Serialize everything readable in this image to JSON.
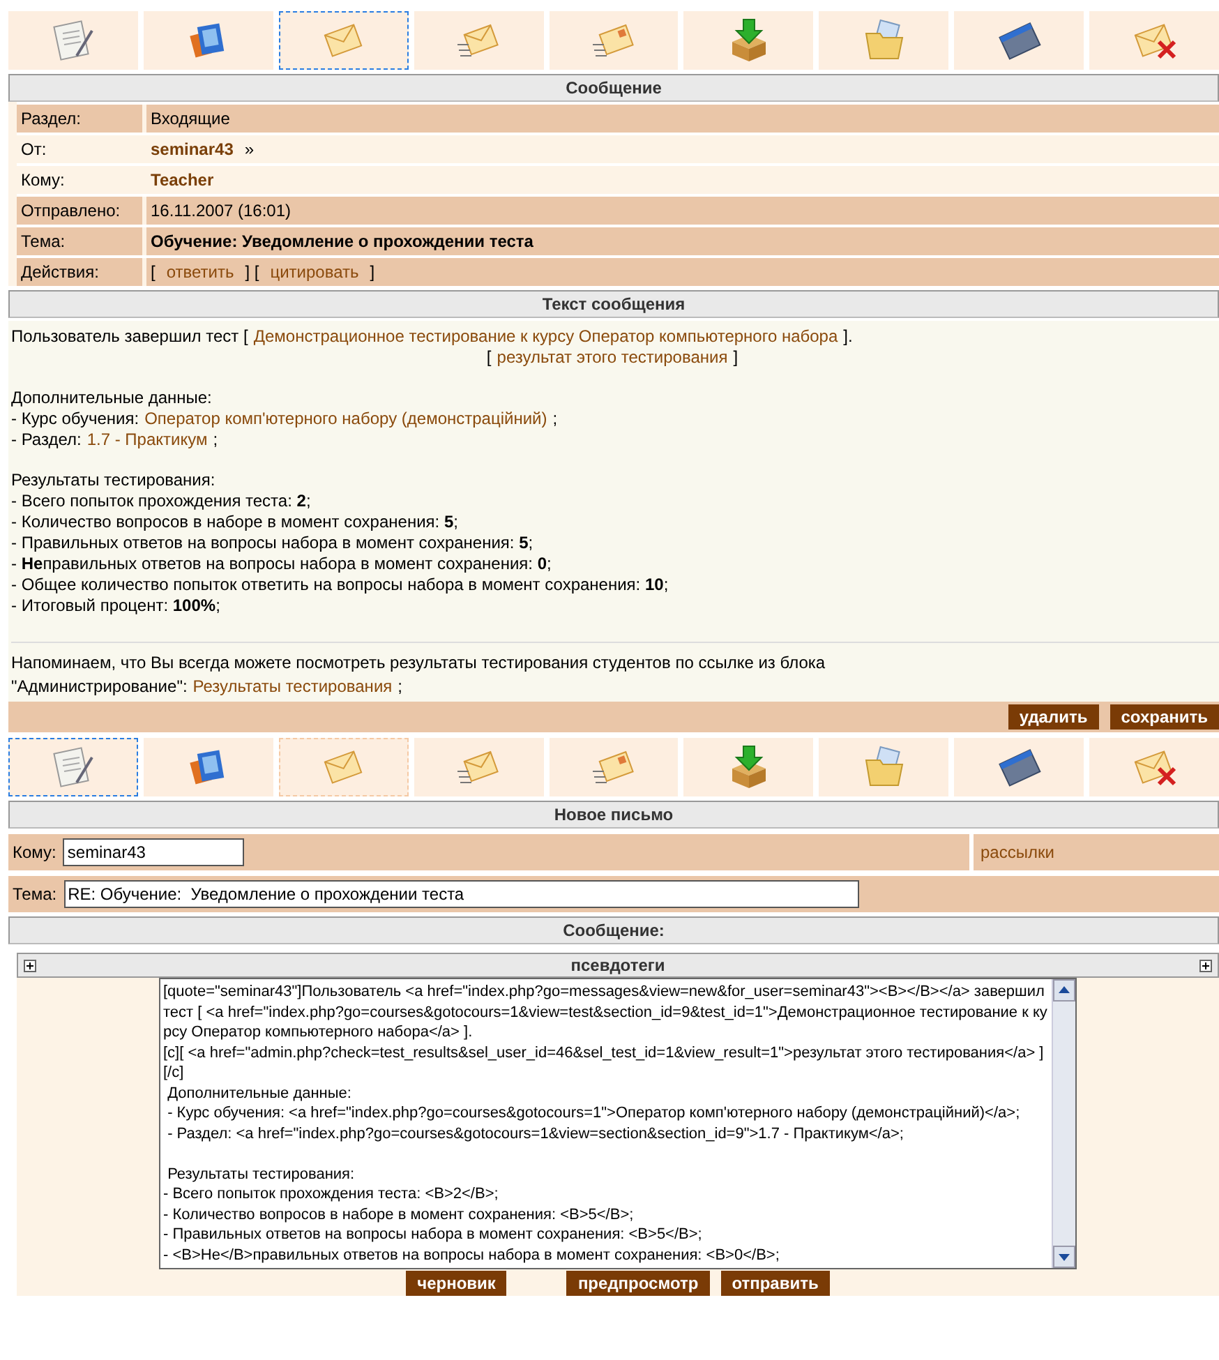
{
  "toolbar_top": [
    {
      "kind": "notepad",
      "focused": false,
      "selected": false
    },
    {
      "kind": "books",
      "focused": false,
      "selected": false
    },
    {
      "kind": "envelope",
      "focused": true,
      "selected": false
    },
    {
      "kind": "envelope-lines",
      "focused": false,
      "selected": false
    },
    {
      "kind": "envelope-stamp",
      "focused": false,
      "selected": false
    },
    {
      "kind": "box-arrow",
      "focused": false,
      "selected": false
    },
    {
      "kind": "folder",
      "focused": false,
      "selected": false
    },
    {
      "kind": "window",
      "focused": false,
      "selected": false
    },
    {
      "kind": "envelope-cross",
      "focused": false,
      "selected": false
    }
  ],
  "message": {
    "title": "Сообщение",
    "fields": [
      {
        "label": "Раздел:",
        "highlighted": true,
        "segments": [
          {
            "kind": "text",
            "text": "Входящие"
          }
        ]
      },
      {
        "label": "От:",
        "highlighted": false,
        "segments": [
          {
            "kind": "user",
            "text": "seminar43"
          },
          {
            "kind": "text",
            "text": "»"
          }
        ]
      },
      {
        "label": "Кому:",
        "highlighted": false,
        "segments": [
          {
            "kind": "user",
            "text": "Teacher"
          }
        ]
      },
      {
        "label": "Отправлено:",
        "highlighted": true,
        "segments": [
          {
            "kind": "text",
            "text": "16.11.2007 (16:01)"
          }
        ]
      },
      {
        "label": "Тема:",
        "highlighted": true,
        "segments": [
          {
            "kind": "strong",
            "text": "Обучение: Уведомление о прохождении теста"
          }
        ]
      },
      {
        "label": "Действия:",
        "highlighted": true,
        "segments": [
          {
            "kind": "text",
            "text": "["
          },
          {
            "kind": "link",
            "text": "ответить"
          },
          {
            "kind": "text",
            "text": "] ["
          },
          {
            "kind": "link",
            "text": "цитировать"
          },
          {
            "kind": "text",
            "text": "]"
          }
        ]
      }
    ]
  },
  "body": {
    "title": "Текст сообщения",
    "paragraphs": [
      {
        "lines": [
          {
            "kind": "plain",
            "segments": [
              {
                "kind": "text",
                "text": "Пользователь завершил тест ["
              },
              {
                "kind": "link",
                "text": "Демонстрационное тестирование к курсу Оператор компьютерного набора"
              },
              {
                "kind": "text",
                "text": "]."
              }
            ]
          },
          {
            "kind": "centered",
            "segments": [
              {
                "kind": "text",
                "text": "["
              },
              {
                "kind": "link",
                "text": "результат этого тестирования"
              },
              {
                "kind": "text",
                "text": "]"
              }
            ]
          }
        ]
      },
      {
        "lines": [
          {
            "kind": "plain",
            "segments": [
              {
                "kind": "text",
                "text": "Дополнительные данные:"
              }
            ]
          },
          {
            "kind": "plain",
            "segments": [
              {
                "kind": "text",
                "text": "- Курс обучения:"
              },
              {
                "kind": "link",
                "text": "Оператор комп'ютерного набору (демонстраційний)"
              },
              {
                "kind": "text",
                "text": ";"
              }
            ]
          },
          {
            "kind": "plain",
            "segments": [
              {
                "kind": "text",
                "text": "- Раздел:"
              },
              {
                "kind": "link",
                "text": "1.7 - Практикум"
              },
              {
                "kind": "text",
                "text": ";"
              }
            ]
          }
        ]
      },
      {
        "lines": [
          {
            "kind": "plain",
            "segments": [
              {
                "kind": "text",
                "text": "Результаты тестирования:"
              }
            ]
          },
          {
            "kind": "plain",
            "segments": [
              {
                "kind": "text",
                "text": "- Всего попыток прохождения теста: **2**;"
              }
            ]
          },
          {
            "kind": "plain",
            "segments": [
              {
                "kind": "text",
                "text": "- Количество вопросов в наборе в момент сохранения: **5**;"
              }
            ]
          },
          {
            "kind": "plain",
            "segments": [
              {
                "kind": "text",
                "text": "- Правильных ответов на вопросы набора в момент сохранения: **5**;"
              }
            ]
          },
          {
            "kind": "plain",
            "segments": [
              {
                "kind": "text",
                "text": "- **Не**правильных ответов на вопросы набора в момент сохранения: **0**;"
              }
            ]
          },
          {
            "kind": "plain",
            "segments": [
              {
                "kind": "text",
                "text": "- Общее количество попыток ответить на вопросы набора в момент сохранения: **10**;"
              }
            ]
          },
          {
            "kind": "plain",
            "segments": [
              {
                "kind": "text",
                "text": "- Итоговый процент: **100%**;"
              }
            ]
          }
        ]
      }
    ],
    "note": {
      "segments": [
        {
          "kind": "text",
          "text": "Напоминаем, что Вы всегда можете посмотреть результаты тестирования студентов по ссылке из блока \"Администрирование\":"
        },
        {
          "kind": "link",
          "text": "Результаты тестирования"
        },
        {
          "kind": "text",
          "text": ";"
        }
      ]
    }
  },
  "message_buttons": [
    "удалить",
    "сохранить"
  ],
  "toolbar_bottom": [
    {
      "kind": "notepad",
      "focused": true,
      "selected": false
    },
    {
      "kind": "books",
      "focused": false,
      "selected": false
    },
    {
      "kind": "envelope",
      "focused": false,
      "selected": true
    },
    {
      "kind": "envelope-lines",
      "focused": false,
      "selected": false
    },
    {
      "kind": "envelope-stamp",
      "focused": false,
      "selected": false
    },
    {
      "kind": "box-arrow",
      "focused": false,
      "selected": false
    },
    {
      "kind": "folder",
      "focused": false,
      "selected": false
    },
    {
      "kind": "window",
      "focused": false,
      "selected": false
    },
    {
      "kind": "envelope-cross",
      "focused": false,
      "selected": false
    }
  ],
  "compose": {
    "title": "Новое письмо",
    "to": {
      "label": "Кому:",
      "value": "seminar43"
    },
    "mailing_link": "рассылки",
    "subject": {
      "label": "Тема:",
      "value": "RE: Обучение:  Уведомление о прохождении теста"
    },
    "message_title": "Сообщение:",
    "pseudotags": {
      "title": "псевдотеги",
      "expanded": false
    },
    "text": "[quote=\"seminar43\"]Пользователь <a href=\"index.php?go=messages&view=new&for_user=seminar43\"><B></B></a> завершил тест [ <a href=\"index.php?go=courses&gotocours=1&view=test&section_id=9&test_id=1\">Демонстрационное тестирование к курсу Оператор компьютерного набора</a> ].\n[c][ <a href=\"admin.php?check=test_results&sel_user_id=46&sel_test_id=1&view_result=1\">результат этого тестирования</a> ][/c]\n Дополнительные данные:\n - Курс обучения: <a href=\"index.php?go=courses&gotocours=1\">Оператор комп'ютерного набору (демонстраційний)</a>;\n - Раздел: <a href=\"index.php?go=courses&gotocours=1&view=section&section_id=9\">1.7 - Практикум</a>;\n\n Результаты тестирования:\n- Всего попыток прохождения теста: <B>2</B>;\n- Количество вопросов в наборе в момент сохранения: <B>5</B>;\n- Правильных ответов на вопросы набора в момент сохранения: <B>5</B>;\n- <B>Не</B>правильных ответов на вопросы набора в момент сохранения: <B>0</B>;",
    "buttons": [
      "черновик",
      "предпросмотр",
      "отправить"
    ]
  }
}
